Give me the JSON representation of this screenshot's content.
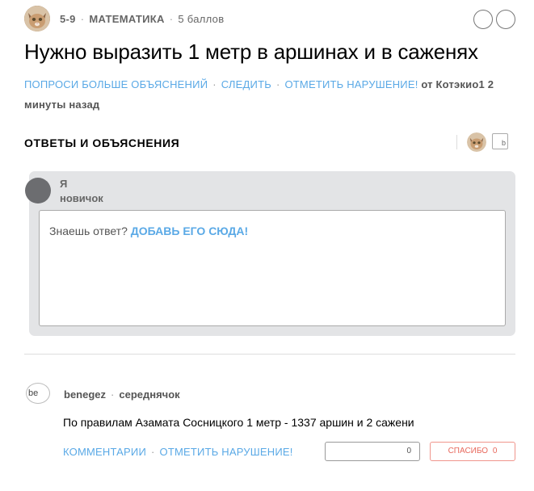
{
  "question": {
    "grade": "5-9",
    "subject": "МАТЕМАТИКА",
    "points": "5 баллов",
    "title": "Нужно выразить 1 метр в аршинах и в саженях",
    "actions": {
      "ask_more": "ПОПРОСИ БОЛЬШЕ ОБЪЯСНЕНИЙ",
      "follow": "СЛЕДИТЬ",
      "report": "ОТМЕТИТЬ НАРУШЕНИЕ!"
    },
    "author_prefix": "от",
    "author": "Котэкио1",
    "time_ago": "2 минуты назад"
  },
  "answers_section": {
    "title": "ОТВЕТЫ И ОБЪЯСНЕНИЯ",
    "broken_avatar_alt": "b"
  },
  "composer": {
    "user_name": "Я",
    "user_rank": "новичок",
    "prompt": "Знаешь ответ?",
    "cta": "ДОБАВЬ ЕГО СЮДА!"
  },
  "answer": {
    "avatar_alt": "be",
    "user": "benegez",
    "rank": "середнячок",
    "text": "По правилам Азамата Сосницкого 1 метр - 1337 аршин и 2 сажени",
    "comments_label": "КОММЕНТАРИИ",
    "report_label": "ОТМЕТИТЬ НАРУШЕНИЕ!",
    "rating_count": "0",
    "thanks_label": "СПАСИБО",
    "thanks_count": "0"
  },
  "colors": {
    "link": "#5aa9e6",
    "box_bg": "#e3e4e6",
    "thanks": "#e8685c"
  },
  "icons": {
    "cat_avatar": "cat-avatar-icon",
    "circle_button": "circle-outline-icon",
    "broken_image": "broken-image-icon"
  }
}
